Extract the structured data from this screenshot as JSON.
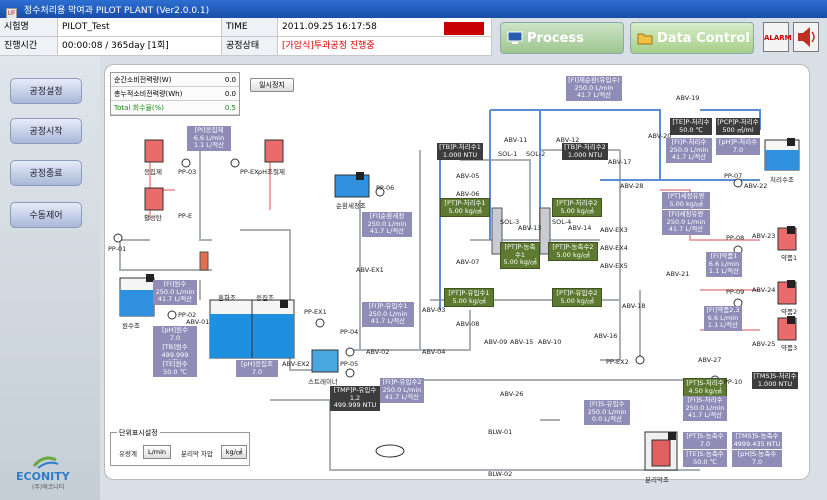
{
  "window": {
    "title": "정수처리용 막여과 PILOT PLANT (Ver2.0.0.1)"
  },
  "info": {
    "test_name_label": "시험명",
    "test_name": "PILOT_Test",
    "time_label": "TIME",
    "time": "2011.09.25 16:17:58",
    "log_button": "LOG",
    "run_time_label": "진행시간",
    "run_time": "00:00:08 / 365day [1회]",
    "status_label": "공정상태",
    "status": "[가압식]투과공정 진행중"
  },
  "top_buttons": {
    "process_control": "Process Control",
    "data_control": "Data Control",
    "alarm": "ALARM"
  },
  "sidebar": {
    "items": [
      "공정설정",
      "공정시작",
      "공정종료",
      "수동제어"
    ],
    "logo": "ECONITY",
    "logo_sub": "(주)에코니티"
  },
  "stats": {
    "rows": [
      {
        "label": "순간소비전력량(W)",
        "value": "0.0"
      },
      {
        "label": "총누적소비전력량(Wh)",
        "value": "0.0"
      },
      {
        "label": "Total 회수율(%)",
        "value": "0.5"
      }
    ],
    "pause_button": "일시정지"
  },
  "tags": {
    "pi_bigo": [
      "[PI]응집제",
      "6.6 L/min",
      "1.1 L/적산"
    ],
    "pi_wonsu": [
      "[FI]원수",
      "250.0 L/min",
      "41.7 L/적산"
    ],
    "ph_wonsu": [
      "[pH]원수",
      "7.0"
    ],
    "tb_wonsu": [
      "[TB]원수",
      "499.999 NTU"
    ],
    "te_wonsu": [
      "[TE]원수",
      "50.0 ℃"
    ],
    "ph_coag": [
      "[pH]응집조",
      "7.0"
    ],
    "fi_mix": [
      "[FI]순환세정",
      "250.0 L/min",
      "41.7 L/적산"
    ],
    "tb_p1": [
      "[TB]P-처리수1",
      "1.000 NTU"
    ],
    "tb_p2": [
      "[TB]P-처리수2",
      "1.000 NTU"
    ],
    "pt_p1": [
      "[PT]P-처리수1",
      "5.00 kg/㎠"
    ],
    "pt_p2": [
      "[PT]P-처리수2",
      "5.00 kg/㎠"
    ],
    "pt_c1": [
      "[PT]P-농축수1",
      "5.00 kg/㎠"
    ],
    "pt_c2": [
      "[PT]P-농축수2",
      "5.00 kg/㎠"
    ],
    "pt_in1": [
      "[PT]P-유입수1",
      "5.00 kg/㎠"
    ],
    "pt_in2": [
      "[PT]P-유입수2",
      "5.00 kg/㎠"
    ],
    "fi_in1": [
      "[FI]P-유입수1",
      "250.0 L/min",
      "41.7 L/적산"
    ],
    "tmp_in": [
      "[TMP]P-유입수1,2",
      "499.999 NTU"
    ],
    "fi_in2": [
      "[FI]P-유입수2",
      "250.0 L/min",
      "41.7 L/적산"
    ],
    "fi_recycle": [
      "[FI]재순환(유입수)",
      "250.0 L/min",
      "41.7 L/적산"
    ],
    "te_treated": [
      "[TE]P-처리수",
      "50.0 ℃"
    ],
    "pcp_treated": [
      "[PCP]P-처리수",
      "500 ㎥/ml"
    ],
    "fi_treated": [
      "[FI]P-처리수",
      "250.0 L/min",
      "41.7 L/적산"
    ],
    "ph_treated": [
      "[pH]P-처리수",
      "7.0"
    ],
    "pt_wash": [
      "[PT]세정유량",
      "5.00 kg/㎠"
    ],
    "fi_wash": [
      "[FI]세정유량",
      "250.0 L/min",
      "41.7 L/적산"
    ],
    "fi_chem1": [
      "[FI]약품1",
      "6.6 L/min",
      "1.1 L/적산"
    ],
    "fi_chem23": [
      "[FI]약품2,3",
      "6.6 L/min",
      "1.1 L/적산"
    ],
    "tms_treated": [
      "[TMS]S-처리수",
      "1.000 NTU"
    ],
    "pt_s_treated": [
      "[PT]S-처리수",
      "4.50 kg/㎠"
    ],
    "fi_s_treated": [
      "[FI]S-처리수",
      "250.0 L/min",
      "41.7 L/적산"
    ],
    "fi_s_inflow": [
      "[FI]S-유입수",
      "250.0 L/min",
      "0.0 L/적산"
    ],
    "pt_s_conc": [
      "[PT]S-농축수",
      "7.0"
    ],
    "tms_conc": [
      "[TMS]S-농축수",
      "4999.435 NTU"
    ],
    "te_s_conc": [
      "[TE]S-농축수",
      "50.0 ℃"
    ],
    "ph_s_conc": [
      "[pH]S-농축수",
      "7.0"
    ]
  },
  "labels": {
    "coag_tank": "응집제",
    "ph_tank": "pH조절제",
    "carbon": "활성탄",
    "raw_tank": "원수조",
    "mix_tank": "혼화조",
    "floc_tank": "응집조",
    "recycle_tank": "순환세정조",
    "strainer": "스트레이너",
    "treated_tank": "처리수조",
    "chem1": "약품1",
    "chem2": "약품2",
    "chem3": "약품3",
    "sep_tank": "분리막조",
    "pp01": "PP-01",
    "pp02": "PP-02",
    "pp03": "PP-03",
    "ppex": "PP-EX",
    "ppe": "PP-E",
    "ppex1": "PP-EX1",
    "ppex2": "PP-EX2",
    "pp04": "PP-04",
    "pp05": "PP-05",
    "pp06": "PP-06",
    "pp07": "PP-07",
    "pp08": "PP-08",
    "pp09": "PP-09",
    "pp10": "PP-10",
    "abv01": "ABV-01",
    "abvex1": "ABV-EX1",
    "abvex2": "ABV-EX2",
    "abvex3": "ABV-EX3",
    "abvex4": "ABV-EX4",
    "abvex5": "ABV-EX5",
    "abv02": "ABV-02",
    "abv03": "ABV-03",
    "abv04": "ABV-04",
    "abv05": "ABV-05",
    "abv06": "ABV-06",
    "abv07": "ABV-07",
    "abv08": "ABV-08",
    "abv09": "ABV-09",
    "abv10": "ABV-10",
    "abv11": "ABV-11",
    "abv12": "ABV-12",
    "abv13": "ABV-13",
    "abv14": "ABV-14",
    "abv15": "ABV-15",
    "abv16": "ABV-16",
    "abv17": "ABV-17",
    "abv18": "ABV-18",
    "abv19": "ABV-19",
    "abv20": "ABV-20",
    "abv21": "ABV-21",
    "abv22": "ABV-22",
    "abv23": "ABV-23",
    "abv24": "ABV-24",
    "abv25": "ABV-25",
    "abv26": "ABV-26",
    "abv27": "ABV-27",
    "abv28": "ABV-28",
    "sol1": "SOL-1",
    "sol2": "SOL-2",
    "sol3": "SOL-3",
    "sol4": "SOL-4",
    "blw01": "BLW-01",
    "blw02": "BLW-02"
  },
  "unit_panel": {
    "title": "단위표시설정",
    "flow_label": "유량계",
    "flow_unit": "L/min",
    "pressure_label": "분리막 차압",
    "pressure_unit": "kg/㎠"
  }
}
